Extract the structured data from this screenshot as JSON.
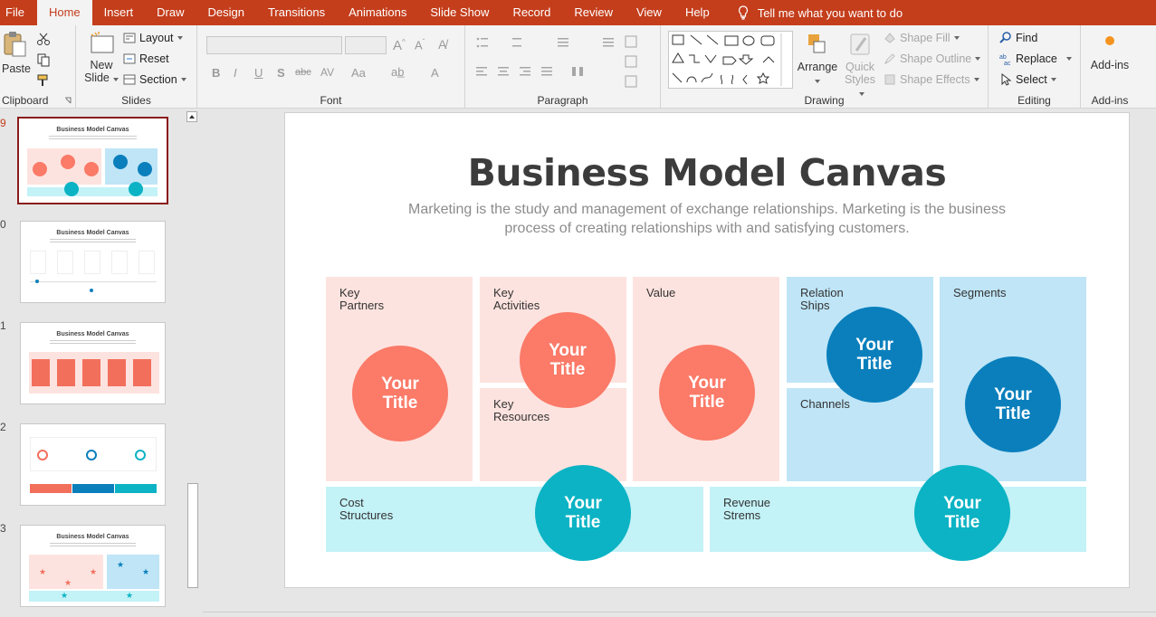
{
  "tabs": [
    {
      "label": "File",
      "active": false
    },
    {
      "label": "Home",
      "active": true
    },
    {
      "label": "Insert",
      "active": false
    },
    {
      "label": "Draw",
      "active": false
    },
    {
      "label": "Design",
      "active": false
    },
    {
      "label": "Transitions",
      "active": false
    },
    {
      "label": "Animations",
      "active": false
    },
    {
      "label": "Slide Show",
      "active": false
    },
    {
      "label": "Record",
      "active": false
    },
    {
      "label": "Review",
      "active": false
    },
    {
      "label": "View",
      "active": false
    },
    {
      "label": "Help",
      "active": false
    }
  ],
  "tell_me": "Tell me what you want to do",
  "ribbon": {
    "clipboard": {
      "paste": "Paste",
      "label": "Clipboard"
    },
    "slides": {
      "new_slide_1": "New",
      "new_slide_2": "Slide",
      "layout": "Layout",
      "reset": "Reset",
      "section": "Section",
      "label": "Slides"
    },
    "font": {
      "label": "Font",
      "bold": "B",
      "italic": "I",
      "underline": "U",
      "shadow": "S",
      "strike": "abc",
      "spacing": "AV",
      "case": "Aa",
      "color": "A"
    },
    "paragraph": {
      "label": "Paragraph"
    },
    "drawing": {
      "label": "Drawing",
      "arrange": "Arrange",
      "quick_styles_1": "Quick",
      "quick_styles_2": "Styles",
      "shape_fill": "Shape Fill",
      "shape_outline": "Shape Outline",
      "shape_effects": "Shape Effects"
    },
    "editing": {
      "label": "Editing",
      "find": "Find",
      "replace": "Replace",
      "select": "Select"
    },
    "addins": {
      "label": "Add-ins",
      "button": "Add-ins"
    }
  },
  "thumbnails": [
    {
      "num": "9",
      "title": "Business Model Canvas",
      "active": true
    },
    {
      "num": "0",
      "title": "Business Model Canvas",
      "active": false
    },
    {
      "num": "1",
      "title": "Business Model Canvas",
      "active": false
    },
    {
      "num": "2",
      "title": "",
      "active": false
    },
    {
      "num": "3",
      "title": "Business Model Canvas",
      "active": false
    }
  ],
  "slide": {
    "title": "Business Model Canvas",
    "subtitle": "Marketing is the study and management of exchange relationships. Marketing is the business process of creating relationships with and satisfying customers.",
    "cells": {
      "key_partners": "Key\nPartners",
      "key_activities": "Key\nActivities",
      "key_resources": "Key\nResources",
      "value": "Value",
      "relationships": "Relation\nShips",
      "channels": "Channels",
      "segments": "Segments",
      "cost_structures": "Cost\nStructures",
      "revenue_streams": "Revenue\nStrems"
    },
    "circle_text": "Your\nTitle"
  },
  "colors": {
    "accent": "#c43e1c",
    "pink": "#fde3df",
    "light_blue": "#bfe5f7",
    "cyan": "#c3f2f7",
    "salmon": "#fb7a68",
    "blue": "#0a7fbc",
    "teal": "#0bb3c4"
  }
}
